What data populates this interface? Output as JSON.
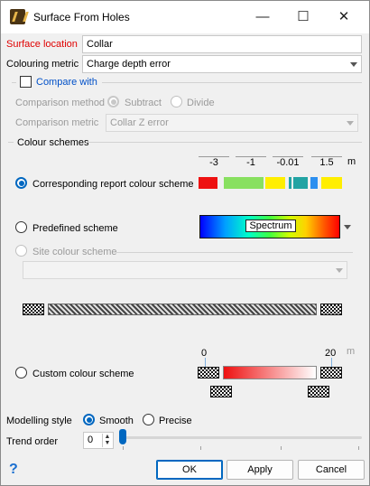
{
  "window": {
    "title": "Surface From Holes",
    "minimize": "—",
    "maximize": "☐",
    "close": "✕"
  },
  "surface_location": {
    "label": "Surface location",
    "value": "Collar"
  },
  "colouring_metric": {
    "label": "Colouring metric",
    "value": "Charge depth error"
  },
  "compare": {
    "label": "Compare with",
    "method_label": "Comparison method",
    "method_subtract": "Subtract",
    "method_divide": "Divide",
    "metric_label": "Comparison metric",
    "metric_value": "Collar Z error"
  },
  "colour_schemes": {
    "group_label": "Colour schemes",
    "unit": "m",
    "ticks": [
      "-3",
      "-1",
      "-0.01",
      "1.5"
    ],
    "report_option": "Corresponding report colour scheme",
    "predefined_option": "Predefined scheme",
    "predefined_value": "Spectrum",
    "site_option": "Site colour scheme",
    "custom_option": "Custom colour scheme",
    "custom_min": "0",
    "custom_max": "20",
    "colors": {
      "red": "#ee1111",
      "green": "#88e060",
      "yellow": "#ffee00",
      "teal": "#22a3a3",
      "blue": "#2c8ff0"
    }
  },
  "modelling_style": {
    "label": "Modelling style",
    "smooth": "Smooth",
    "precise": "Precise"
  },
  "trend_order": {
    "label": "Trend order",
    "value": "0"
  },
  "buttons": {
    "help": "?",
    "ok": "OK",
    "apply": "Apply",
    "cancel": "Cancel"
  }
}
